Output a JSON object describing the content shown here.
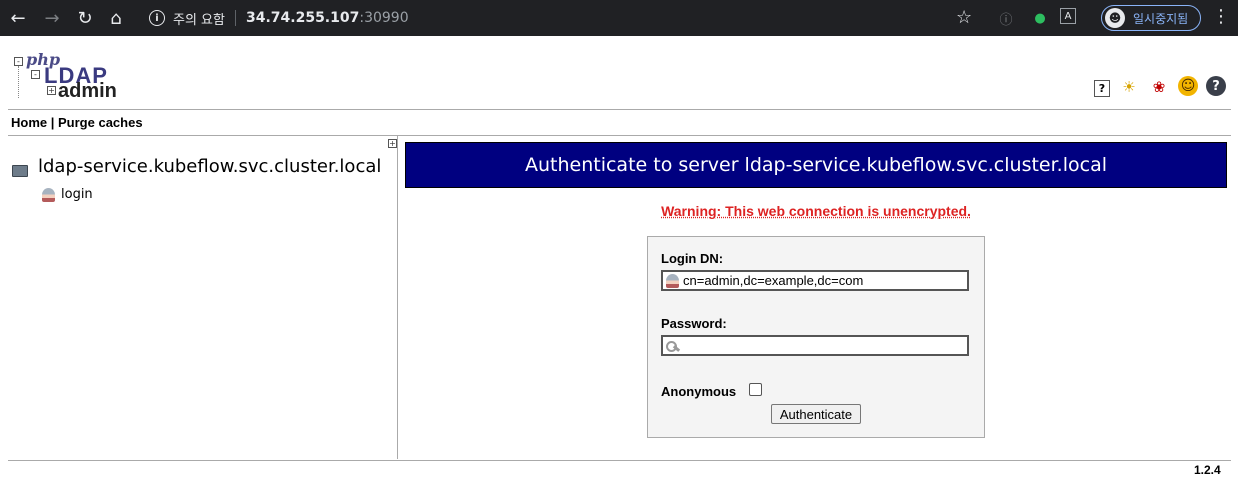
{
  "browser": {
    "security_warning": "주의 요함",
    "url_host": "34.74.255.107",
    "url_port": ":30990",
    "profile_label": "일시중지됨"
  },
  "app": {
    "logo": {
      "php": "php",
      "ldap": "LDAP",
      "admin": "admin"
    },
    "menu": {
      "home": "Home",
      "separator": "|",
      "purge": "Purge caches"
    },
    "tool_icons": [
      "help-icon",
      "bulb-icon",
      "bug-icon",
      "smile-icon",
      "question-icon"
    ]
  },
  "tree": {
    "server": "ldap-service.kubeflow.svc.cluster.local",
    "items": [
      {
        "label": "login"
      }
    ]
  },
  "auth": {
    "title": "Authenticate to server ldap-service.kubeflow.svc.cluster.local",
    "warning": "Warning: This web connection is unencrypted.",
    "login_dn_label": "Login DN:",
    "login_dn_value": "cn=admin,dc=example,dc=com",
    "password_label": "Password:",
    "password_value": "",
    "anonymous_label": "Anonymous",
    "anonymous_checked": false,
    "submit_label": "Authenticate"
  },
  "footer": {
    "version": "1.2.4"
  },
  "colors": {
    "title_bar": "#000080",
    "warning": "#dd2222",
    "chrome": "#202124"
  }
}
